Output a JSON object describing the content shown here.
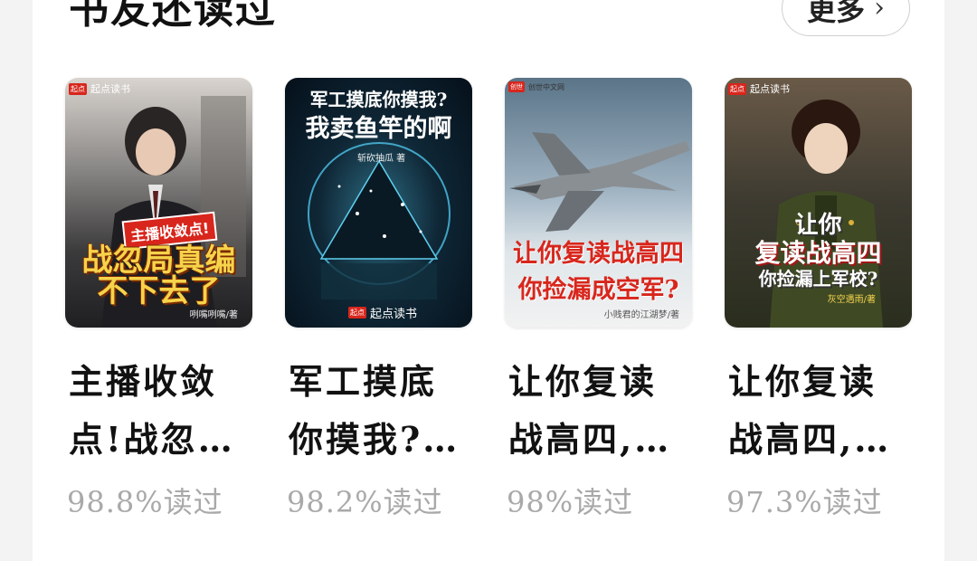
{
  "section": {
    "title": "书友还读过",
    "more_label": "更多"
  },
  "books": [
    {
      "title": "主播收敛点!战忽局真编不下去了",
      "read_pct": "98.8%读过",
      "cover": {
        "publisher": "起点读书",
        "tagline": "主播收敛点!",
        "title": "战忽局真编不下去了",
        "author": "咧嘴咧嘴/著"
      }
    },
    {
      "title": "军工摸底你摸我?我卖鱼竿的啊",
      "read_pct": "98.2%读过",
      "cover": {
        "publisher": "起点读书",
        "title_line1": "军工摸底你摸我?",
        "title_line2": "我卖鱼竿的啊",
        "author": "斩砍抽瓜 著"
      }
    },
    {
      "title": "让你复读战高四,你捡漏成空军?",
      "read_pct": "98%读过",
      "cover": {
        "publisher": "创世中文网",
        "title_line1": "让你复读战高四",
        "title_line2": "你捡漏成空军?",
        "author": "小贱君的江湖梦/著"
      }
    },
    {
      "title": "让你复读战高四,你捡漏上军校?",
      "read_pct": "97.3%读过",
      "cover": {
        "publisher": "起点读书",
        "title_line1": "让你",
        "title_line2": "复读战高四",
        "title_line3": "你捡漏上军校?",
        "author": "灰空遇雨/著"
      }
    }
  ]
}
